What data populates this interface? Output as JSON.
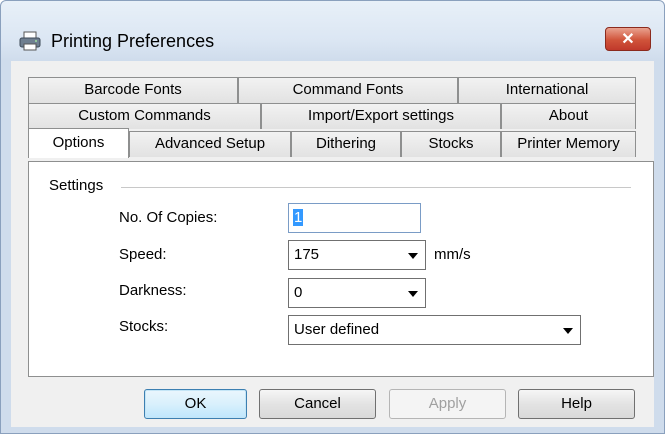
{
  "window": {
    "title": "Printing Preferences",
    "close_glyph": "✕"
  },
  "tabs": {
    "row1": [
      {
        "label": "Barcode Fonts"
      },
      {
        "label": "Command Fonts"
      },
      {
        "label": "International"
      }
    ],
    "row2": [
      {
        "label": "Custom Commands"
      },
      {
        "label": "Import/Export settings"
      },
      {
        "label": "About"
      }
    ],
    "row3": [
      {
        "label": "Options",
        "active": true
      },
      {
        "label": "Advanced Setup"
      },
      {
        "label": "Dithering"
      },
      {
        "label": "Stocks"
      },
      {
        "label": "Printer Memory"
      }
    ]
  },
  "settings": {
    "group_label": "Settings",
    "copies": {
      "label": "No. Of Copies:",
      "value": "1"
    },
    "speed": {
      "label": "Speed:",
      "value": "175",
      "unit": "mm/s"
    },
    "darkness": {
      "label": "Darkness:",
      "value": "0"
    },
    "stocks": {
      "label": "Stocks:",
      "value": "User defined"
    }
  },
  "buttons": {
    "ok": "OK",
    "cancel": "Cancel",
    "apply": "Apply",
    "help": "Help"
  },
  "colors": {
    "close_button": "#c0392b",
    "selection": "#3399ff"
  }
}
